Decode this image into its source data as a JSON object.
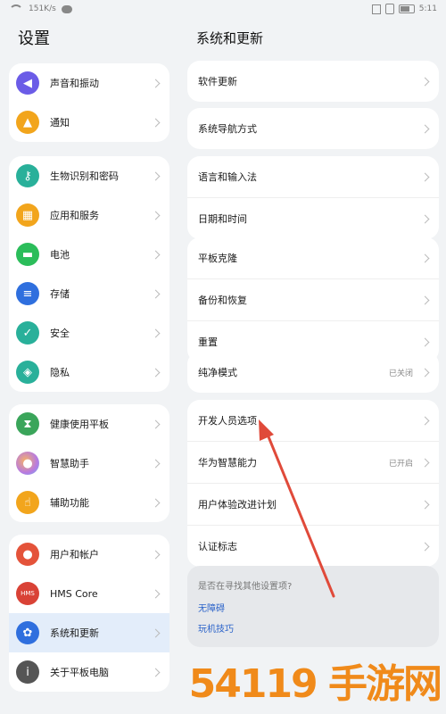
{
  "status": {
    "speed": "151K/s",
    "time": "5:11"
  },
  "left": {
    "title": "设置",
    "groups": [
      [
        {
          "label": "声音和振动",
          "icon": "speaker-icon",
          "color": "#6b5ce7"
        },
        {
          "label": "通知",
          "icon": "bell-icon",
          "color": "#f2a51c"
        }
      ],
      [
        {
          "label": "生物识别和密码",
          "icon": "key-icon",
          "color": "#29b09a"
        },
        {
          "label": "应用和服务",
          "icon": "grid-icon",
          "color": "#f2a51c"
        },
        {
          "label": "电池",
          "icon": "battery-icon",
          "color": "#2bbd5a"
        },
        {
          "label": "存储",
          "icon": "storage-icon",
          "color": "#2f6fde"
        },
        {
          "label": "安全",
          "icon": "shield-icon",
          "color": "#29b09a"
        },
        {
          "label": "隐私",
          "icon": "privacy-icon",
          "color": "#29b09a"
        }
      ],
      [
        {
          "label": "健康使用平板",
          "icon": "hourglass-icon",
          "color": "#3aa55a"
        },
        {
          "label": "智慧助手",
          "icon": "assistant-icon",
          "color": "#b87ae0"
        },
        {
          "label": "辅助功能",
          "icon": "hand-icon",
          "color": "#f2a51c"
        }
      ],
      [
        {
          "label": "用户和帐户",
          "icon": "user-icon",
          "color": "#e4533a"
        },
        {
          "label": "HMS Core",
          "icon": "hms-icon",
          "color": "#d94236"
        },
        {
          "label": "系统和更新",
          "icon": "gear-icon",
          "color": "#2f6fde",
          "selected": true
        },
        {
          "label": "关于平板电脑",
          "icon": "info-icon",
          "color": "#555555"
        }
      ]
    ]
  },
  "right": {
    "title": "系统和更新",
    "groups": [
      [
        {
          "label": "软件更新"
        }
      ],
      [
        {
          "label": "系统导航方式"
        }
      ],
      [
        {
          "label": "语言和输入法"
        },
        {
          "label": "日期和时间"
        }
      ],
      [
        {
          "label": "平板克隆"
        },
        {
          "label": "备份和恢复"
        },
        {
          "label": "重置"
        }
      ],
      [
        {
          "label": "纯净模式",
          "value": "已关闭"
        }
      ],
      [
        {
          "label": "开发人员选项"
        },
        {
          "label": "华为智慧能力",
          "value": "已开启"
        },
        {
          "label": "用户体验改进计划"
        },
        {
          "label": "认证标志"
        }
      ]
    ],
    "hint": {
      "question": "是否在寻找其他设置项?",
      "links": [
        "无障碍",
        "玩机技巧"
      ]
    }
  },
  "watermark": "54119 手游网",
  "colors": {
    "accent": "#2f6fde",
    "arrow": "#e04a3a",
    "watermark": "#f08a1a"
  }
}
